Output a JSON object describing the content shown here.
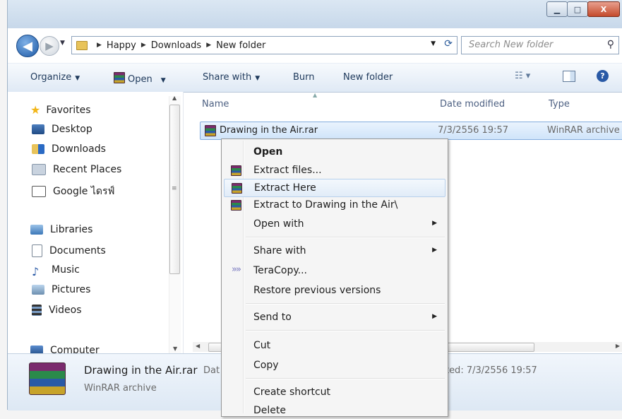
{
  "window": {
    "minimize_glyph": "▁",
    "maximize_glyph": "□",
    "close_glyph": "X"
  },
  "address": {
    "crumbs": [
      "Happy",
      "Downloads",
      "New folder"
    ],
    "search_placeholder": "Search New folder"
  },
  "toolbar": {
    "organize": "Organize",
    "open": "Open",
    "share_with": "Share with",
    "burn": "Burn",
    "new_folder": "New folder",
    "help": "?"
  },
  "nav": {
    "favorites": "Favorites",
    "desktop": "Desktop",
    "downloads": "Downloads",
    "recent_places": "Recent Places",
    "google_drive": "Google ไดรฟ์",
    "libraries": "Libraries",
    "documents": "Documents",
    "music": "Music",
    "pictures": "Pictures",
    "videos": "Videos",
    "computer": "Computer"
  },
  "columns": {
    "name": "Name",
    "date_modified": "Date modified",
    "type": "Type"
  },
  "file": {
    "name": "Drawing in the Air.rar",
    "date_modified": "7/3/2556 19:57",
    "type": "WinRAR archive"
  },
  "context_menu": {
    "open": "Open",
    "extract_files": "Extract files...",
    "extract_here": "Extract Here",
    "extract_to": "Extract to Drawing in the Air\\",
    "open_with": "Open with",
    "share_with": "Share with",
    "teracopy": "TeraCopy...",
    "restore": "Restore previous versions",
    "send_to": "Send to",
    "cut": "Cut",
    "copy": "Copy",
    "create_shortcut": "Create shortcut",
    "delete": "Delete"
  },
  "details": {
    "name": "Drawing in the Air.rar",
    "type": "WinRAR archive",
    "date_label_partial": "Dat",
    "modified_partial": "ated:  7/3/2556 19:57"
  }
}
